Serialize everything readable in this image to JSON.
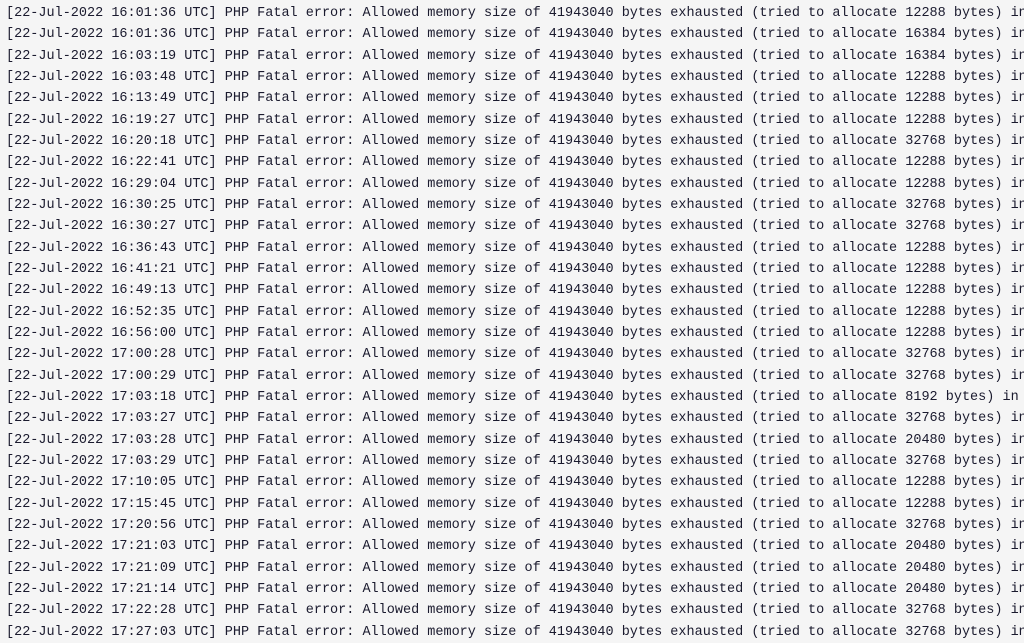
{
  "log": {
    "date": "22-Jul-2022",
    "tz": "UTC",
    "error_label": "PHP Fatal error:",
    "msg_prefix": "Allowed memory size of",
    "mem_limit": "41943040",
    "msg_mid": "bytes exhausted (tried to allocate",
    "msg_suffix_in": "bytes) in",
    "msg_suffix_in_trail": "bytes) in /",
    "entries": [
      {
        "time": "16:01:36",
        "alloc": "12288"
      },
      {
        "time": "16:01:36",
        "alloc": "16384"
      },
      {
        "time": "16:03:19",
        "alloc": "16384"
      },
      {
        "time": "16:03:48",
        "alloc": "12288"
      },
      {
        "time": "16:13:49",
        "alloc": "12288"
      },
      {
        "time": "16:19:27",
        "alloc": "12288"
      },
      {
        "time": "16:20:18",
        "alloc": "32768"
      },
      {
        "time": "16:22:41",
        "alloc": "12288"
      },
      {
        "time": "16:29:04",
        "alloc": "12288"
      },
      {
        "time": "16:30:25",
        "alloc": "32768"
      },
      {
        "time": "16:30:27",
        "alloc": "32768"
      },
      {
        "time": "16:36:43",
        "alloc": "12288"
      },
      {
        "time": "16:41:21",
        "alloc": "12288"
      },
      {
        "time": "16:49:13",
        "alloc": "12288"
      },
      {
        "time": "16:52:35",
        "alloc": "12288"
      },
      {
        "time": "16:56:00",
        "alloc": "12288"
      },
      {
        "time": "17:00:28",
        "alloc": "32768"
      },
      {
        "time": "17:00:29",
        "alloc": "32768"
      },
      {
        "time": "17:03:18",
        "alloc": "8192",
        "trail": true
      },
      {
        "time": "17:03:27",
        "alloc": "32768"
      },
      {
        "time": "17:03:28",
        "alloc": "20480"
      },
      {
        "time": "17:03:29",
        "alloc": "32768"
      },
      {
        "time": "17:10:05",
        "alloc": "12288"
      },
      {
        "time": "17:15:45",
        "alloc": "12288"
      },
      {
        "time": "17:20:56",
        "alloc": "32768"
      },
      {
        "time": "17:21:03",
        "alloc": "20480"
      },
      {
        "time": "17:21:09",
        "alloc": "20480"
      },
      {
        "time": "17:21:14",
        "alloc": "20480"
      },
      {
        "time": "17:22:28",
        "alloc": "32768"
      },
      {
        "time": "17:27:03",
        "alloc": "32768"
      }
    ]
  }
}
